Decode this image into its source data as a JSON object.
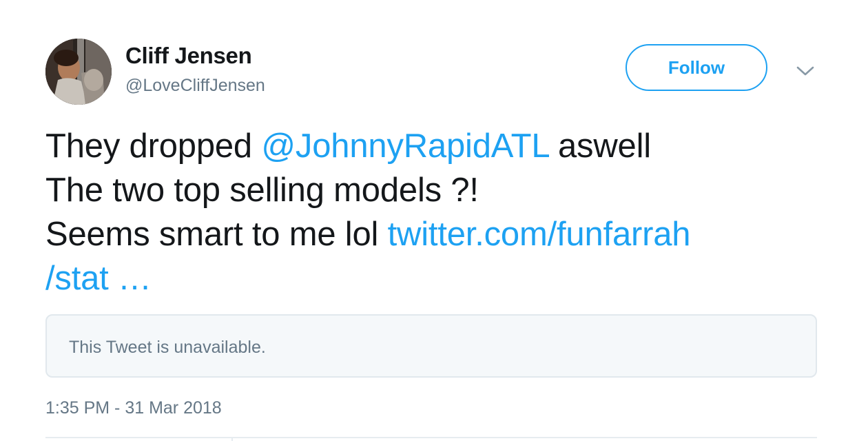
{
  "user": {
    "name": "Cliff Jensen",
    "handle": "@LoveCliffJensen"
  },
  "actions": {
    "follow_label": "Follow"
  },
  "tweet": {
    "line1_before": "They dropped ",
    "line1_mention": "@JohnnyRapidATL",
    "line1_after": " aswell",
    "line2": "The two top selling models ?!",
    "line3_text": "Seems smart to me lol ",
    "line3_link": "twitter.com/funfarrah",
    "line4_link": "/stat …"
  },
  "quote": {
    "text": "This Tweet is unavailable."
  },
  "timestamp": "1:35 PM - 31 Mar 2018",
  "colors": {
    "accent": "#1da1f2",
    "text_primary": "#14171a",
    "text_secondary": "#657786",
    "quote_bg": "#f5f8fa",
    "border": "#e1e8ed"
  },
  "icons": {
    "avatar": "profile-photo",
    "menu": "chevron-down-icon"
  }
}
